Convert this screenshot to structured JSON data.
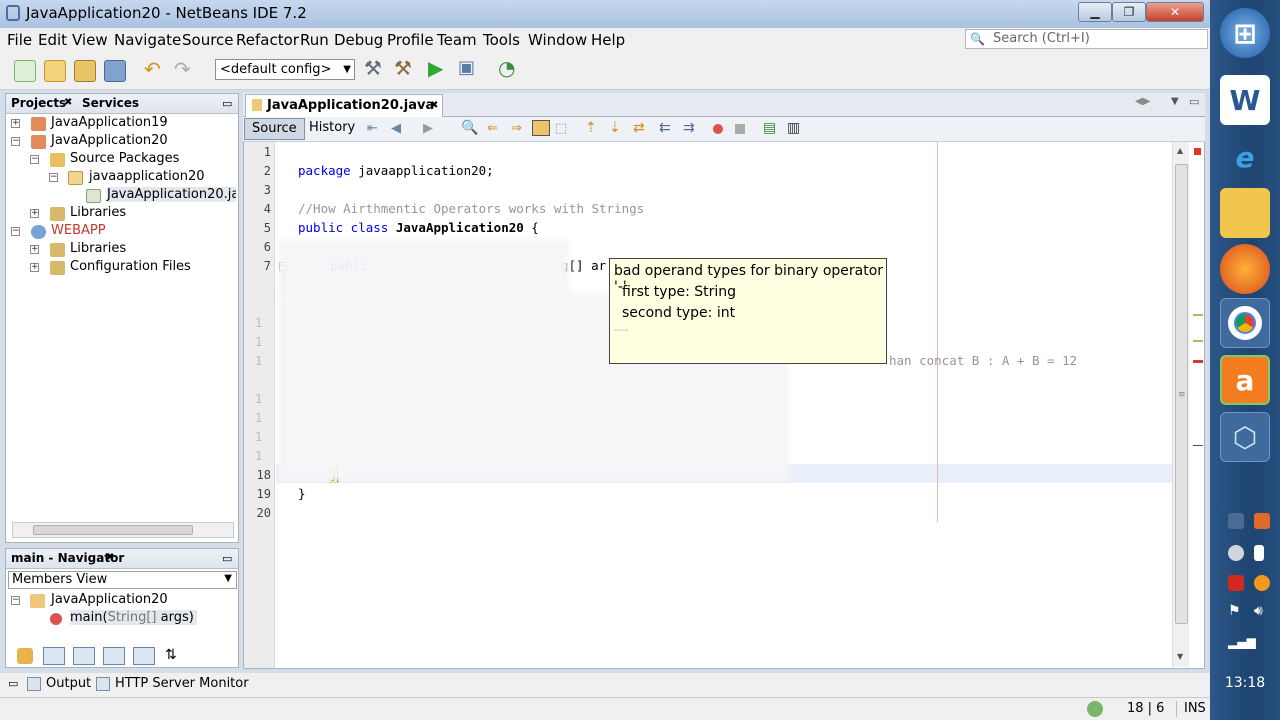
{
  "window": {
    "title": "JavaApplication20 - NetBeans IDE 7.2",
    "minimize_label": "▁",
    "maximize_label": "❐",
    "close_label": "✕"
  },
  "menu": [
    "File",
    "Edit",
    "View",
    "Navigate",
    "Source",
    "Refactor",
    "Run",
    "Debug",
    "Profile",
    "Team",
    "Tools",
    "Window",
    "Help"
  ],
  "search": {
    "placeholder": "Search (Ctrl+I)",
    "icon": "search-icon"
  },
  "toolbar": {
    "config": "<default config>"
  },
  "projects_panel": {
    "tabs": [
      "Projects",
      "Services"
    ],
    "tree": [
      {
        "label": "JavaApplication19",
        "icon": "java-project-icon"
      },
      {
        "label": "JavaApplication20",
        "icon": "java-project-icon"
      },
      {
        "label": "Source Packages",
        "icon": "source-packages-icon"
      },
      {
        "label": "javaapplication20",
        "icon": "package-icon"
      },
      {
        "label": "JavaApplication20.java",
        "icon": "java-file-icon"
      },
      {
        "label": "Libraries",
        "icon": "libraries-icon"
      },
      {
        "label": "WEBAPP",
        "icon": "web-project-icon"
      },
      {
        "label": "Libraries",
        "icon": "libraries-icon"
      },
      {
        "label": "Configuration Files",
        "icon": "config-files-icon"
      }
    ]
  },
  "navigator": {
    "title": "main - Navigator",
    "view": "Members View",
    "items": [
      {
        "label": "JavaApplication20"
      },
      {
        "label_method": "main(",
        "label_param": "String[]",
        "label_rest": " args)"
      }
    ]
  },
  "editor": {
    "file_tab": "JavaApplication20.java",
    "view_tabs": [
      "Source",
      "History"
    ],
    "lines": {
      "l1": "1",
      "l2": "2",
      "l3": "3",
      "l4": "4",
      "l5": "5",
      "l6": "6",
      "l7": "7",
      "l18": "18",
      "l19": "19",
      "l20": "20",
      "l11": "1",
      "l12": "1",
      "l13": "1",
      "l15": "1",
      "l16": "1",
      "l17a": "1",
      "l17b": "1"
    },
    "code": {
      "package_kw": "package",
      "package_name": " javaapplication20;",
      "comment": "//How Airthmentic Operators works with Strings",
      "class_kw": "public class",
      "class_name": " JavaApplication20",
      "class_brace": " {",
      "main_partial": "publi",
      "args_partial": "g[] ar",
      "trailing_comment": "han concat B : A + B = 12",
      "close_main": "}",
      "close_class": "}"
    }
  },
  "tooltip": {
    "line1": "bad operand types for binary operator '-'",
    "line2": "first type:  String",
    "line3": "second type: int",
    "line4": "----"
  },
  "bottom": {
    "output": "Output",
    "http_monitor": "HTTP Server Monitor"
  },
  "status": {
    "position": "18 | 6",
    "mode": "INS"
  },
  "taskbar": {
    "clock": "13:18"
  }
}
